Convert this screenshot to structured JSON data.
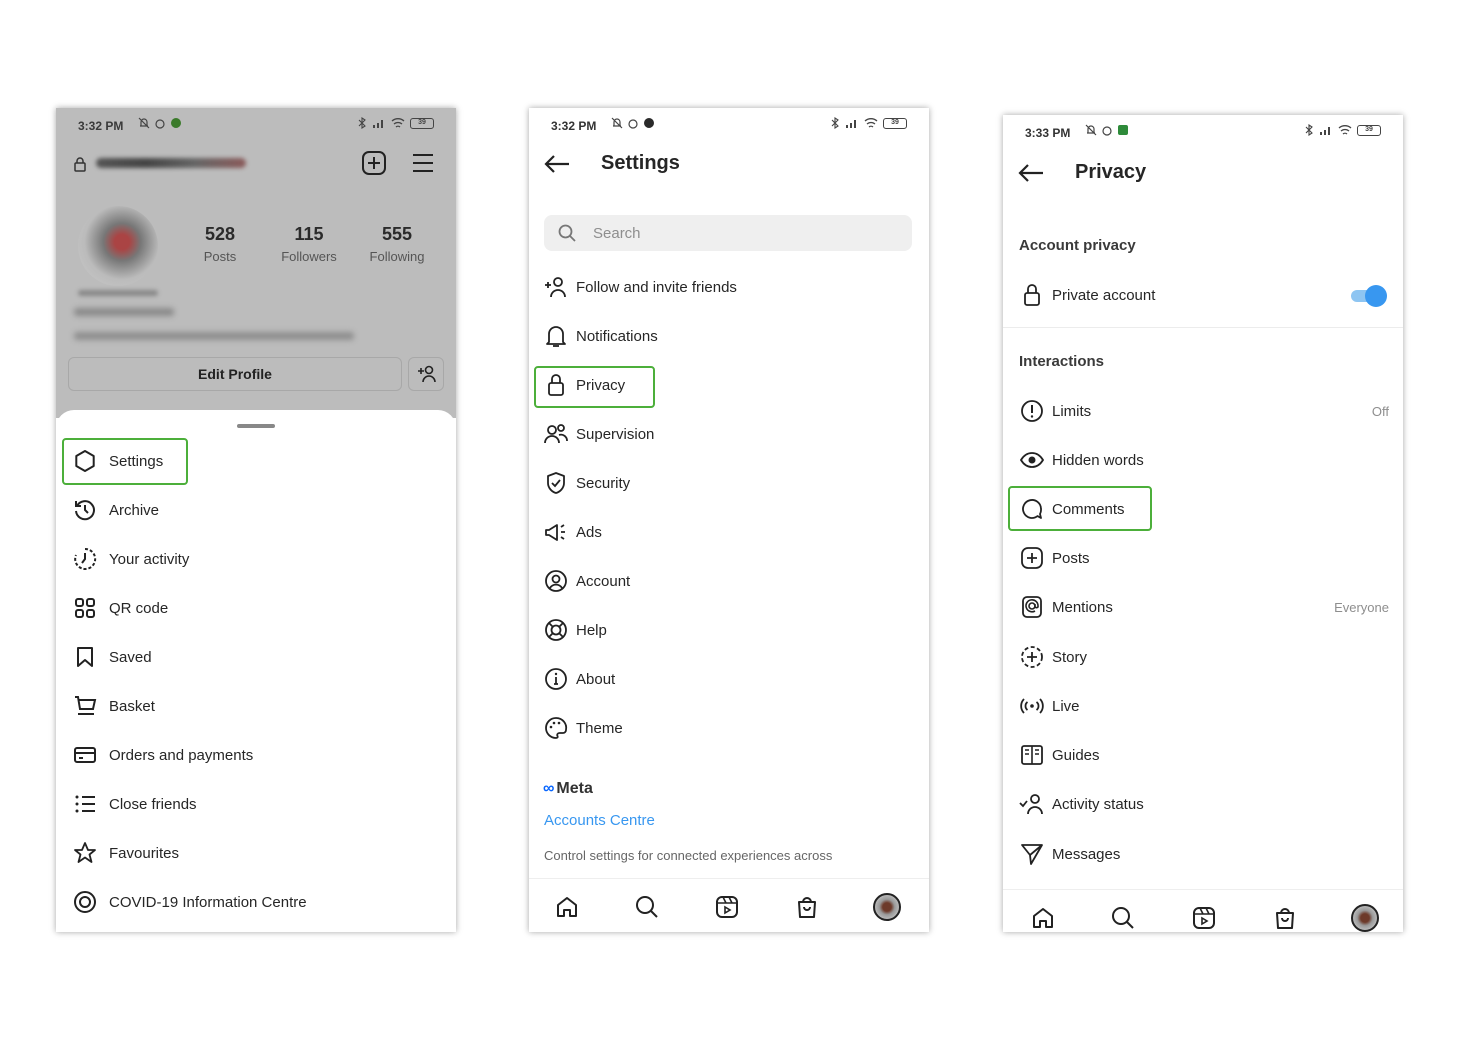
{
  "phone1": {
    "status": {
      "time": "3:32 PM",
      "battery": "39"
    },
    "profile": {
      "posts_count": "528",
      "posts_label": "Posts",
      "followers_count": "115",
      "followers_label": "Followers",
      "following_count": "555",
      "following_label": "Following",
      "edit_profile": "Edit Profile"
    },
    "menu": [
      {
        "label": "Settings",
        "icon": "settings-icon"
      },
      {
        "label": "Archive",
        "icon": "archive-icon"
      },
      {
        "label": "Your activity",
        "icon": "activity-icon"
      },
      {
        "label": "QR code",
        "icon": "qr-code-icon"
      },
      {
        "label": "Saved",
        "icon": "bookmark-icon"
      },
      {
        "label": "Basket",
        "icon": "cart-icon"
      },
      {
        "label": "Orders and payments",
        "icon": "card-icon"
      },
      {
        "label": "Close friends",
        "icon": "list-icon"
      },
      {
        "label": "Favourites",
        "icon": "star-icon"
      },
      {
        "label": "COVID-19 Information Centre",
        "icon": "covid-icon"
      }
    ]
  },
  "phone2": {
    "status": {
      "time": "3:32 PM",
      "battery": "39"
    },
    "title": "Settings",
    "search_placeholder": "Search",
    "items": [
      {
        "label": "Follow and invite friends",
        "icon": "add-person-icon"
      },
      {
        "label": "Notifications",
        "icon": "bell-icon"
      },
      {
        "label": "Privacy",
        "icon": "lock-icon"
      },
      {
        "label": "Supervision",
        "icon": "supervision-icon"
      },
      {
        "label": "Security",
        "icon": "shield-icon"
      },
      {
        "label": "Ads",
        "icon": "megaphone-icon"
      },
      {
        "label": "Account",
        "icon": "account-icon"
      },
      {
        "label": "Help",
        "icon": "lifebuoy-icon"
      },
      {
        "label": "About",
        "icon": "info-icon"
      },
      {
        "label": "Theme",
        "icon": "palette-icon"
      }
    ],
    "meta": "Meta",
    "accounts_centre": "Accounts Centre",
    "accounts_desc": "Control settings for connected experiences across"
  },
  "phone3": {
    "status": {
      "time": "3:33 PM",
      "battery": "39"
    },
    "title": "Privacy",
    "account_privacy_header": "Account privacy",
    "private_account": "Private account",
    "private_account_on": true,
    "interactions_header": "Interactions",
    "items": [
      {
        "label": "Limits",
        "value": "Off",
        "icon": "alert-circle-icon"
      },
      {
        "label": "Hidden words",
        "value": "",
        "icon": "eye-icon"
      },
      {
        "label": "Comments",
        "value": "",
        "icon": "comment-icon"
      },
      {
        "label": "Posts",
        "value": "",
        "icon": "plus-square-icon"
      },
      {
        "label": "Mentions",
        "value": "Everyone",
        "icon": "at-icon"
      },
      {
        "label": "Story",
        "value": "",
        "icon": "story-icon"
      },
      {
        "label": "Live",
        "value": "",
        "icon": "live-icon"
      },
      {
        "label": "Guides",
        "value": "",
        "icon": "guides-icon"
      },
      {
        "label": "Activity status",
        "value": "",
        "icon": "activity-status-icon"
      },
      {
        "label": "Messages",
        "value": "",
        "icon": "send-icon"
      }
    ]
  },
  "colors": {
    "highlight": "#4caf3a",
    "link": "#3897f0",
    "toggle": "#3897f0"
  }
}
